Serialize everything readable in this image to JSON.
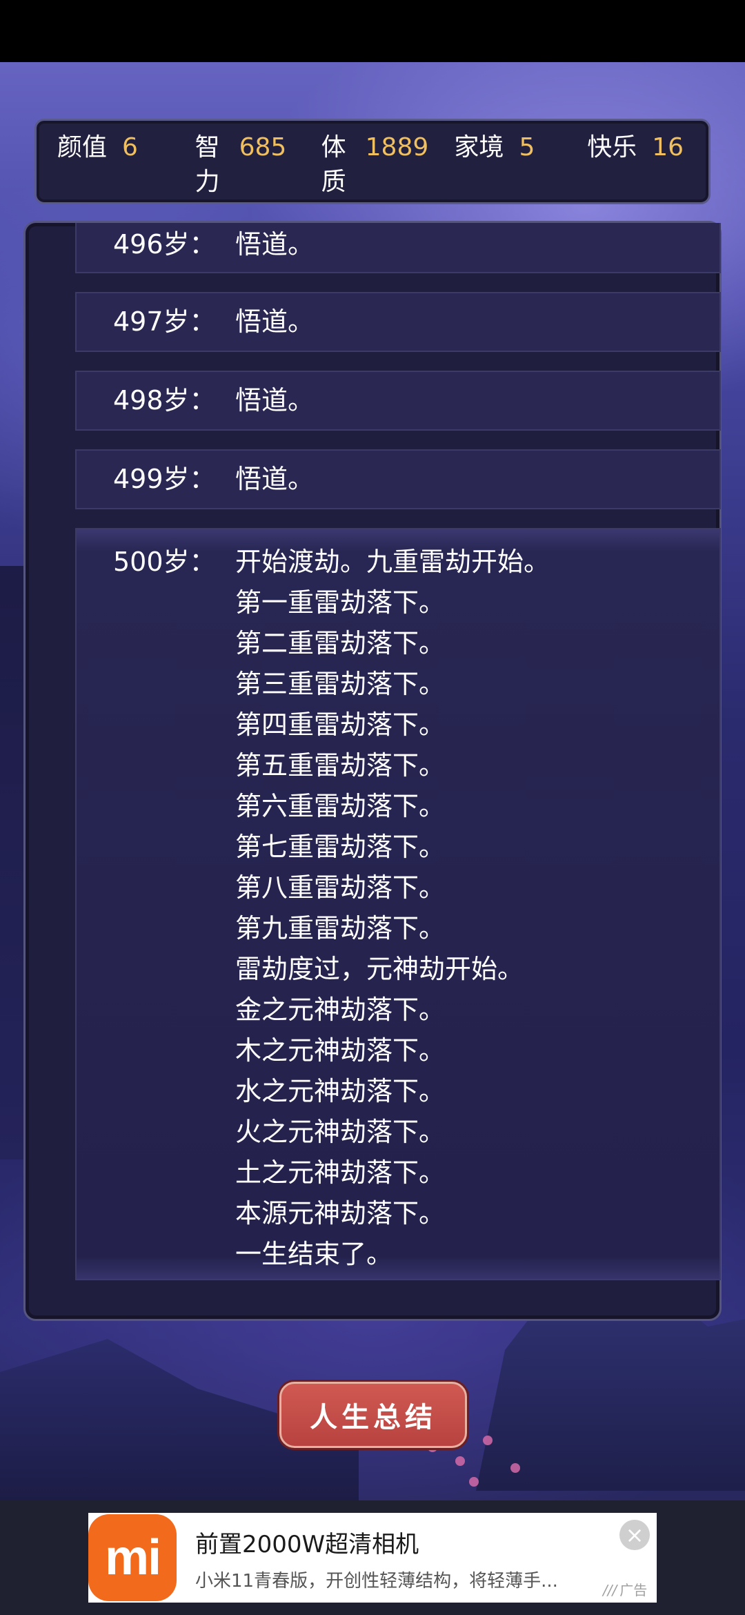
{
  "stats": [
    {
      "label": "颜值",
      "value": "6"
    },
    {
      "label": "智力",
      "value": "685"
    },
    {
      "label": "体质",
      "value": "1889"
    },
    {
      "label": "家境",
      "value": "5"
    },
    {
      "label": "快乐",
      "value": "16"
    }
  ],
  "log": [
    {
      "age": "496岁：",
      "lines": [
        "悟道。"
      ]
    },
    {
      "age": "497岁：",
      "lines": [
        "悟道。"
      ]
    },
    {
      "age": "498岁：",
      "lines": [
        "悟道。"
      ]
    },
    {
      "age": "499岁：",
      "lines": [
        "悟道。"
      ]
    },
    {
      "age": "500岁：",
      "lines": [
        "开始渡劫。九重雷劫开始。",
        "第一重雷劫落下。",
        "第二重雷劫落下。",
        "第三重雷劫落下。",
        "第四重雷劫落下。",
        "第五重雷劫落下。",
        "第六重雷劫落下。",
        "第七重雷劫落下。",
        "第八重雷劫落下。",
        "第九重雷劫落下。",
        "雷劫度过，元神劫开始。",
        "金之元神劫落下。",
        "木之元神劫落下。",
        "水之元神劫落下。",
        "火之元神劫落下。",
        "土之元神劫落下。",
        "本源元神劫落下。",
        "一生结束了。"
      ]
    }
  ],
  "summary_button": "人生总结",
  "ad": {
    "logo": "mi",
    "title": "前置2000W超清相机",
    "subtitle": "小米11青春版，开创性轻薄结构，将轻薄手...",
    "tag": "广告",
    "close_icon": "close-icon"
  }
}
